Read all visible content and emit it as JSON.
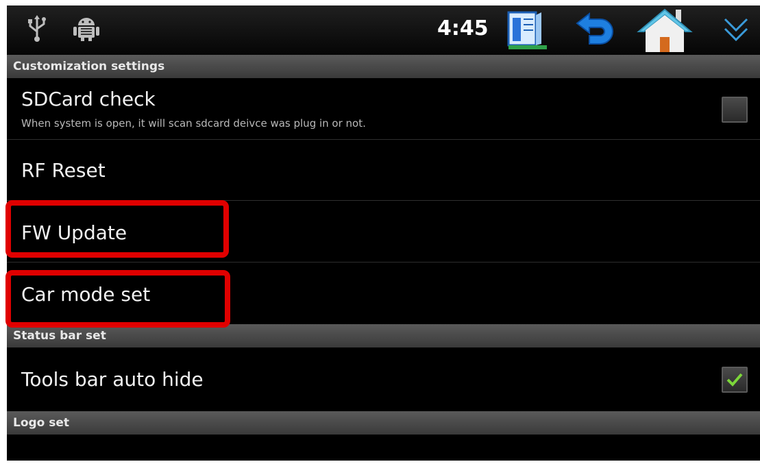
{
  "status_bar": {
    "time": "4:45",
    "left_icons": [
      "usb-icon",
      "android-debug-icon"
    ],
    "right_icons": [
      "menu-icon",
      "back-icon",
      "home-icon",
      "collapse-icon"
    ]
  },
  "sections": {
    "customization": "Customization settings",
    "status_bar_set": "Status bar set",
    "logo_set": "Logo set"
  },
  "settings": {
    "sdcard_check": {
      "title": "SDCard check",
      "summary": "When system is open, it will scan sdcard deivce was plug in or not.",
      "checked": false
    },
    "rf_reset": {
      "title": "RF Reset"
    },
    "fw_update": {
      "title": "FW Update"
    },
    "car_mode_set": {
      "title": "Car mode set"
    },
    "tools_bar_auto_hide": {
      "title": "Tools bar auto hide",
      "checked": true
    }
  },
  "colors": {
    "highlight": "#e00000",
    "check_mark": "#7cd63a",
    "back_arrow": "#1e7fe0",
    "home_roof": "#5fc4e6",
    "home_body": "#f0f0f0"
  }
}
